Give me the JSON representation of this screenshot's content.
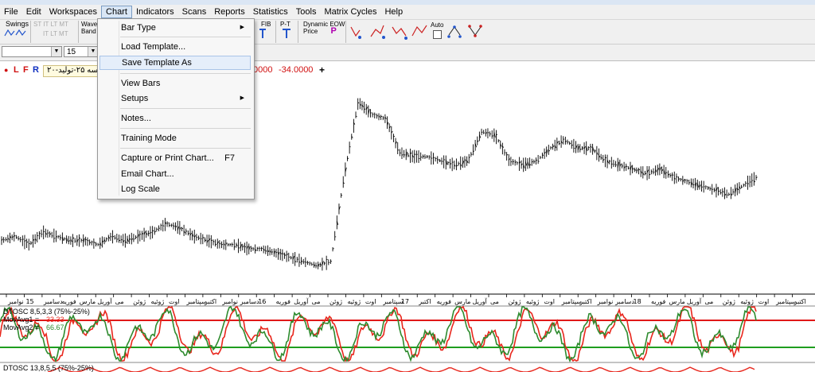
{
  "menubar": {
    "items": [
      "File",
      "Edit",
      "Workspaces",
      "Chart",
      "Indicators",
      "Scans",
      "Reports",
      "Statistics",
      "Tools",
      "Matrix Cycles",
      "Help"
    ],
    "active": "Chart"
  },
  "toolbar": {
    "swings_label": "Swings",
    "swing_options": [
      "ST",
      "IT",
      "LT",
      "MT",
      "IT",
      "LT",
      "MT"
    ],
    "wave_label": "Wave",
    "band_label": "Band",
    "fib_label": "FIB",
    "pt_label": "P-T",
    "dynamic_label": "Dynamic EOW",
    "price_label": "Price",
    "p_glyph": "P",
    "auto_label": "Auto"
  },
  "toolbar2": {
    "combo1_value": "",
    "period_value": "15"
  },
  "infobar": {
    "letters": [
      "L",
      "F",
      "R"
    ],
    "symbol_label": "سه ۲۵-تولید-۲۰",
    "value1": "0000",
    "value2": "-34.0000",
    "plus": "+"
  },
  "chart_menu": {
    "items": [
      {
        "label": "Bar Type",
        "submenu": true
      },
      {
        "label": "Load Template..."
      },
      {
        "label": "Save Template As",
        "highlighted": true
      },
      {
        "label": "View Bars"
      },
      {
        "label": "Setups",
        "submenu": true
      },
      {
        "label": "Notes..."
      },
      {
        "label": "Training Mode"
      },
      {
        "label": "Capture or Print Chart...",
        "shortcut": "F7"
      },
      {
        "label": "Email Chart..."
      },
      {
        "label": "Log Scale"
      }
    ]
  },
  "chart_data": {
    "type": "line",
    "x_axis_labels": [
      "نوامبر",
      "15",
      "دسامبر",
      "فوریه",
      "مارس",
      "آوریل",
      "می",
      "ژوئن",
      "ژوئیه",
      "اوت",
      "سپتامبر",
      "اکتبر",
      "نوامبر",
      "دسامبر",
      "16",
      "فوریه",
      "آوریل",
      "می",
      "ژوئن",
      "ژوئیه",
      "اوت",
      "سپتامبر",
      "17",
      "اکتبر",
      "فوریه",
      "مارس",
      "آوریل",
      "می",
      "ژوئن",
      "ژوئیه",
      "اوت",
      "سپتامبر",
      "اکتبر",
      "نوامبر",
      "دسامبر",
      "18",
      "فوریه",
      "مارس",
      "آوریل",
      "می",
      "ژوئن",
      "ژوئیه",
      "اوت",
      "سپتامبر",
      "اکتبر"
    ],
    "price_series": [
      62,
      63,
      61,
      64,
      63,
      62,
      62,
      61,
      63,
      62,
      63,
      64,
      66,
      65,
      63,
      62,
      61,
      61,
      60,
      60,
      59,
      58,
      57,
      56,
      57,
      78,
      95,
      92,
      91,
      83,
      82,
      82,
      81,
      80,
      81,
      88,
      87,
      81,
      80,
      81,
      84,
      86,
      84,
      84,
      81,
      80,
      79,
      78,
      79,
      77,
      76,
      75,
      74,
      73,
      75,
      77
    ],
    "indicators": [
      {
        "label": "DTOSC 8,5,3,3 (75%-25%)",
        "movavg1_label": "MovAvg1 = ",
        "movavg1": "33.33",
        "movavg2_label": "MovAvg2 = ",
        "movavg2": "66.67",
        "upper_level": 75,
        "lower_level": 25
      },
      {
        "label": "DTOSC 13,8,5,5 (75%-25%)"
      }
    ],
    "colors": {
      "price": "#000000",
      "line1": "#e8261c",
      "line2": "#2e8b2e",
      "level_upper": "#e01818",
      "level_lower": "#1e9e1e"
    }
  }
}
